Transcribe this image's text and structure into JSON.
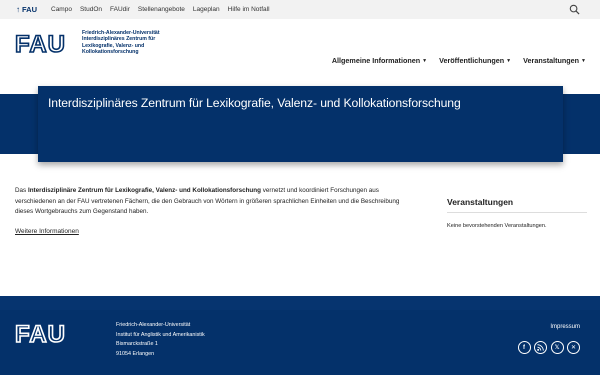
{
  "topbar": {
    "fau_label": "FAU",
    "links": [
      "Campo",
      "StudOn",
      "FAUdir",
      "Stellenangebote",
      "Lageplan",
      "Hilfe im Notfall"
    ]
  },
  "header": {
    "logo_text": "FAU",
    "org_line1": "Friedrich-Alexander-Universität",
    "org_line2": "Interdisziplinäres Zentrum für",
    "org_line3": "Lexikografie, Valenz- und",
    "org_line4": "Kollokationsforschung",
    "nav": [
      "Allgemeine Informationen",
      "Veröffentlichungen",
      "Veranstaltungen"
    ]
  },
  "hero": {
    "title": "Interdisziplinäres Zentrum für Lexikografie, Valenz- und Kollokationsforschung"
  },
  "main": {
    "intro_prefix": "Das ",
    "intro_bold": "Interdisziplinäre Zentrum für Lexikografie, Valenz- und Kollokationsforschung",
    "intro_rest": " vernetzt und koordiniert Forschungen aus verschiedenen an der FAU vertretenen Fächern, die den Gebrauch von Wörtern in größeren sprachlichen Einheiten und die Beschreibung dieses Wortgebrauchs zum Gegenstand haben.",
    "more_link": "Weitere Informationen"
  },
  "aside": {
    "title": "Veranstaltungen",
    "empty_text": "Keine bevorstehenden Veranstaltungen."
  },
  "footer": {
    "logo_text": "FAU",
    "addr_line1": "Friedrich-Alexander-Universität",
    "addr_line2": "Institut für Anglistik und Amerikanistik",
    "addr_line3": "Bismarckstraße 1",
    "addr_line4": "91054 Erlangen",
    "impressum": "Impressum",
    "socials": [
      "facebook-icon",
      "rss-icon",
      "x-icon",
      "xing-icon"
    ]
  },
  "colors": {
    "brand": "#04316a",
    "topbar_bg": "#f2f2f2"
  }
}
